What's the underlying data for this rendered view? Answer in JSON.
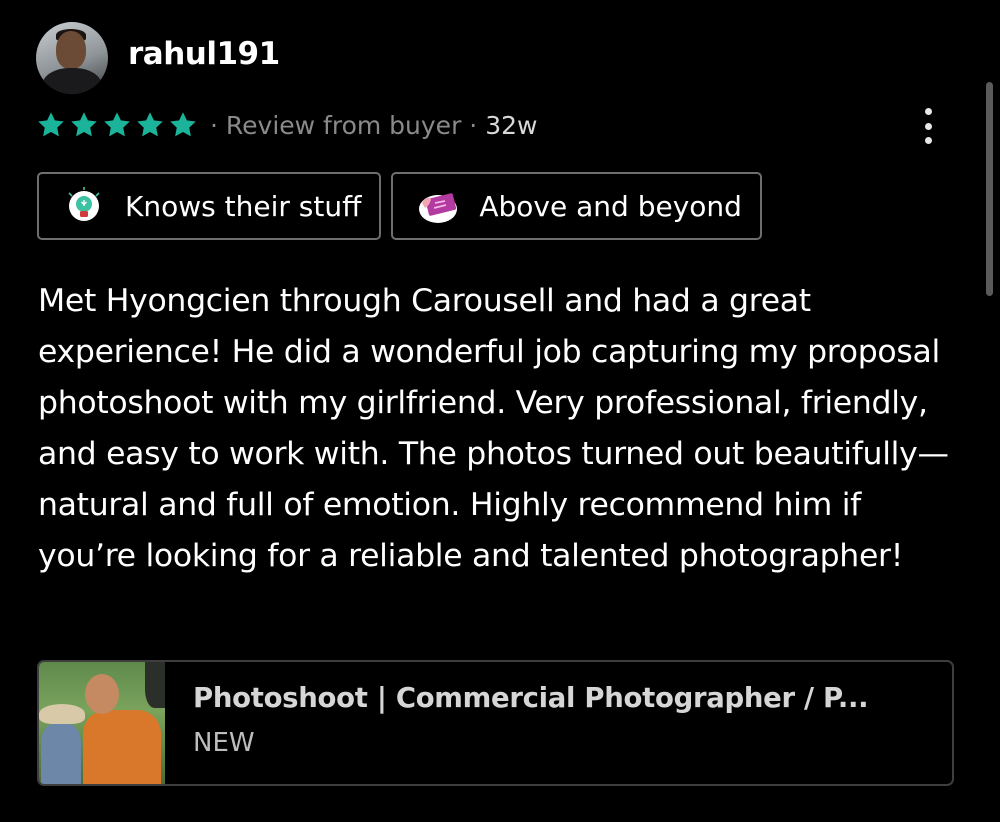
{
  "review": {
    "username": "rahul191",
    "rating": 5,
    "rating_max": 5,
    "star_color": "#1bb39a",
    "source_label": "Review from buyer",
    "age": "32w",
    "separator": "·",
    "tags": [
      {
        "label": "Knows their stuff",
        "icon": "lightbulb-icon"
      },
      {
        "label": "Above and beyond",
        "icon": "ticket-icon"
      }
    ],
    "text": "Met Hyongcien through Carousell and had a great experience! He did a wonderful job capturing my proposal photoshoot with my girlfriend. Very professional, friendly, and easy to work with. The photos turned out beautifully—natural and full of emotion. Highly recommend him if you’re looking for a reliable and talented photographer!",
    "menu_icon": "more-vertical-icon"
  },
  "listing": {
    "title": "Photoshoot | Commercial Photographer / P...",
    "condition": "NEW"
  }
}
